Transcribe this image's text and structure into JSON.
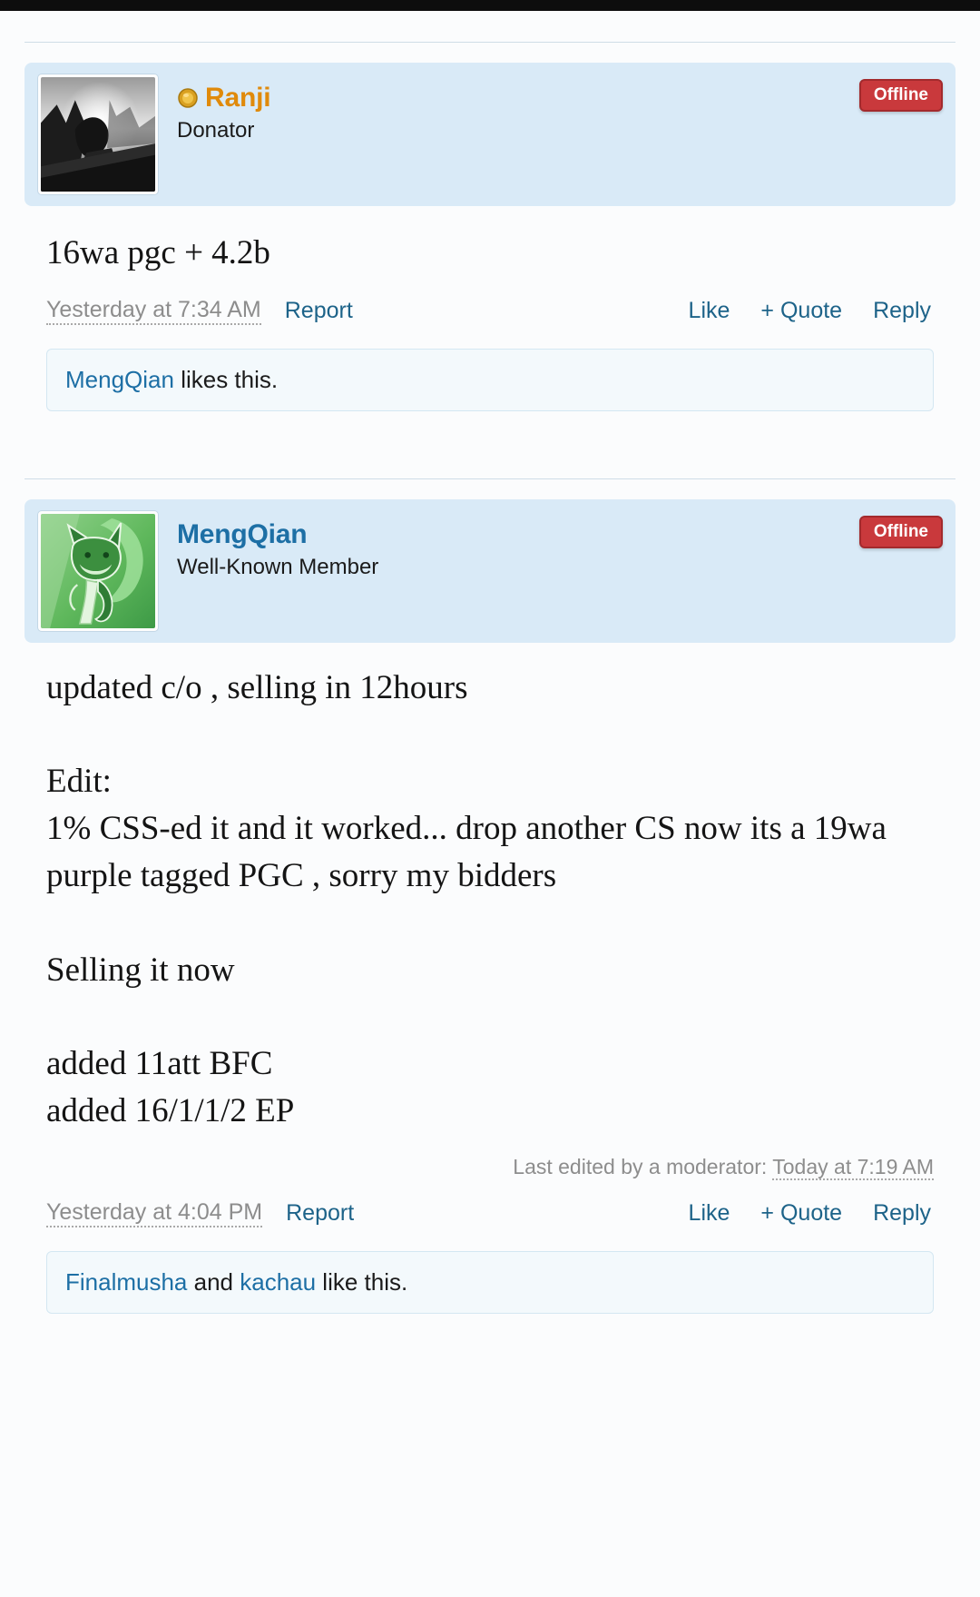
{
  "theme": {
    "header_bg": "#d9eaf7",
    "link_color": "#1d6389",
    "donator_name_color": "#e08a0b",
    "member_name_color": "#1d6fa5",
    "offline_badge_bg": "#c9393c",
    "muted_text": "#8d8d8d",
    "page_bg": "#fbfcfd"
  },
  "posts": [
    {
      "author": {
        "name": "Ranji",
        "title": "Donator",
        "has_coin_icon": true,
        "name_color": "#e08a0b",
        "avatar_alt": "grayscale-artwork-avatar"
      },
      "status_badge": "Offline",
      "body": "16wa pgc + 4.2b",
      "last_edited": null,
      "footer": {
        "timestamp": "Yesterday at 7:34 AM",
        "report_label": "Report",
        "like_label": "Like",
        "quote_label": "+ Quote",
        "reply_label": "Reply"
      },
      "likes": {
        "users": [
          "MengQian"
        ],
        "suffix": " likes this."
      }
    },
    {
      "author": {
        "name": "MengQian",
        "title": "Well-Known Member",
        "has_coin_icon": false,
        "name_color": "#1d6fa5",
        "avatar_alt": "green-anime-cat-avatar"
      },
      "status_badge": "Offline",
      "body": "updated c/o , selling in 12hours\n\nEdit:\n1% CSS-ed it and it worked... drop another CS now its a 19wa purple tagged PGC , sorry my bidders\n\nSelling it now\n\nadded 11att BFC\nadded 16/1/1/2 EP",
      "last_edited": {
        "prefix": "Last edited by a moderator:",
        "time": "Today at 7:19 AM"
      },
      "footer": {
        "timestamp": "Yesterday at 4:04 PM",
        "report_label": "Report",
        "like_label": "Like",
        "quote_label": "+ Quote",
        "reply_label": "Reply"
      },
      "likes": {
        "users": [
          "Finalmusha",
          "kachau"
        ],
        "joiner": " and ",
        "suffix": " like this."
      }
    }
  ]
}
